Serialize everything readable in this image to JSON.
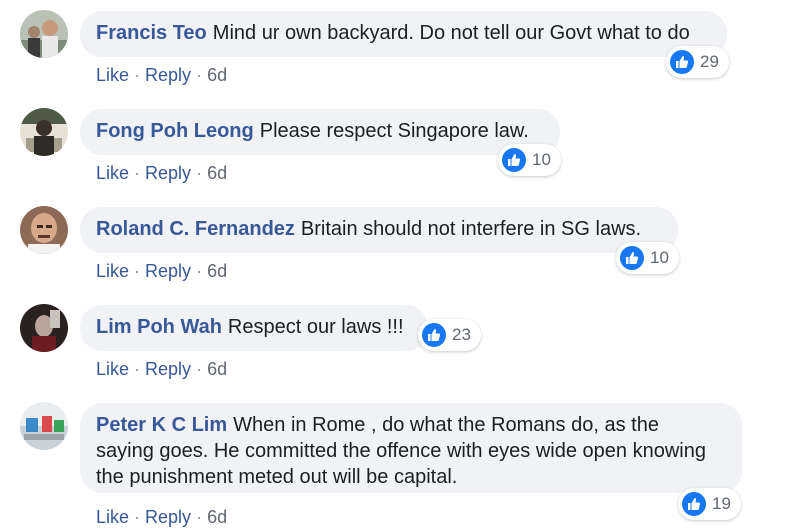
{
  "comments": [
    {
      "author": "Francis Teo",
      "text": "Mind ur own backyard. Do not tell our Govt what to do",
      "like": "Like",
      "reply": "Reply",
      "time": "6d",
      "reactions": "29"
    },
    {
      "author": "Fong Poh Leong",
      "text": "Please respect Singapore law.",
      "like": "Like",
      "reply": "Reply",
      "time": "6d",
      "reactions": "10"
    },
    {
      "author": "Roland C. Fernandez",
      "text": "Britain should not interfere in SG laws.",
      "like": "Like",
      "reply": "Reply",
      "time": "6d",
      "reactions": "10"
    },
    {
      "author": "Lim Poh Wah",
      "text": "Respect our laws !!!",
      "like": "Like",
      "reply": "Reply",
      "time": "6d",
      "reactions": "23"
    },
    {
      "author": "Peter K C Lim",
      "text": "When in Rome , do what the Romans do, as the saying goes. He committed the offence with eyes wide open knowing the punishment meted out will be capital.",
      "like": "Like",
      "reply": "Reply",
      "time": "6d",
      "reactions": "19"
    }
  ],
  "separator": "·",
  "colors": {
    "author": "#385898",
    "bubble": "#f0f2f5",
    "like_badge": "#1877f2"
  },
  "icons": {
    "reaction": "thumbs-up-icon"
  }
}
